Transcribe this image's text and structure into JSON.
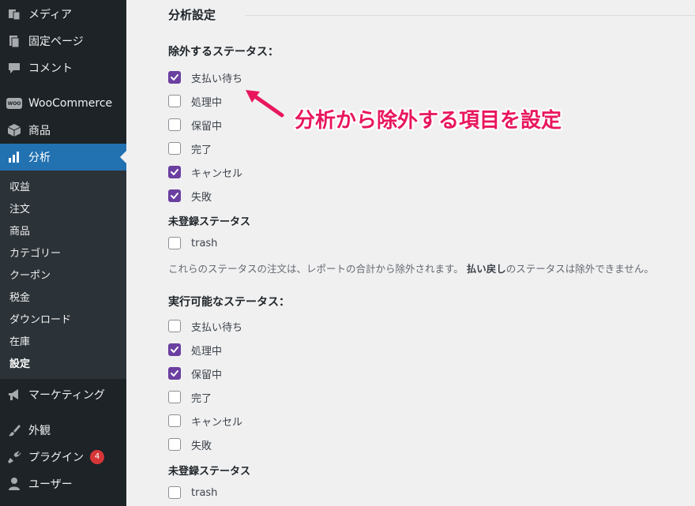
{
  "sidebar": {
    "items": [
      {
        "label": "メディア",
        "icon": "media-icon"
      },
      {
        "label": "固定ページ",
        "icon": "page-icon"
      },
      {
        "label": "コメント",
        "icon": "comment-icon"
      },
      {
        "label": "WooCommerce",
        "icon": "woocommerce-icon"
      },
      {
        "label": "商品",
        "icon": "product-box-icon"
      },
      {
        "label": "分析",
        "icon": "bar-chart-icon"
      },
      {
        "label": "マーケティング",
        "icon": "megaphone-icon"
      },
      {
        "label": "外観",
        "icon": "paintbrush-icon"
      },
      {
        "label": "プラグイン",
        "icon": "plugin-icon",
        "badge": "4"
      },
      {
        "label": "ユーザー",
        "icon": "user-icon"
      }
    ],
    "woo_logo_text": "WOO",
    "submenu": [
      "収益",
      "注文",
      "商品",
      "カテゴリー",
      "クーポン",
      "税金",
      "ダウンロード",
      "在庫",
      "設定"
    ]
  },
  "main": {
    "section_title": "分析設定",
    "excluded": {
      "title": "除外するステータス：",
      "items": [
        {
          "label": "支払い待ち",
          "checked": true
        },
        {
          "label": "処理中",
          "checked": false
        },
        {
          "label": "保留中",
          "checked": false
        },
        {
          "label": "完了",
          "checked": false
        },
        {
          "label": "キャンセル",
          "checked": true
        },
        {
          "label": "失敗",
          "checked": true
        }
      ],
      "unregistered_title": "未登録ステータス",
      "unregistered": [
        {
          "label": "trash",
          "checked": false
        }
      ],
      "description_pre": "これらのステータスの注文は、レポートの合計から除外されます。",
      "description_bold": "払い戻し",
      "description_post": "のステータスは除外できません。"
    },
    "actionable": {
      "title": "実行可能なステータス：",
      "items": [
        {
          "label": "支払い待ち",
          "checked": false
        },
        {
          "label": "処理中",
          "checked": true
        },
        {
          "label": "保留中",
          "checked": true
        },
        {
          "label": "完了",
          "checked": false
        },
        {
          "label": "キャンセル",
          "checked": false
        },
        {
          "label": "失敗",
          "checked": false
        }
      ],
      "unregistered_title": "未登録ステータス",
      "unregistered": [
        {
          "label": "trash",
          "checked": false
        }
      ]
    },
    "annotation": "分析から除外する項目を設定"
  },
  "colors": {
    "sidebar_bg": "#1d2327",
    "submenu_bg": "#2c3338",
    "current_menu": "#2271b1",
    "checkbox_checked": "#6b3fa0",
    "annotation": "#e8175d",
    "badge": "#d63638"
  }
}
